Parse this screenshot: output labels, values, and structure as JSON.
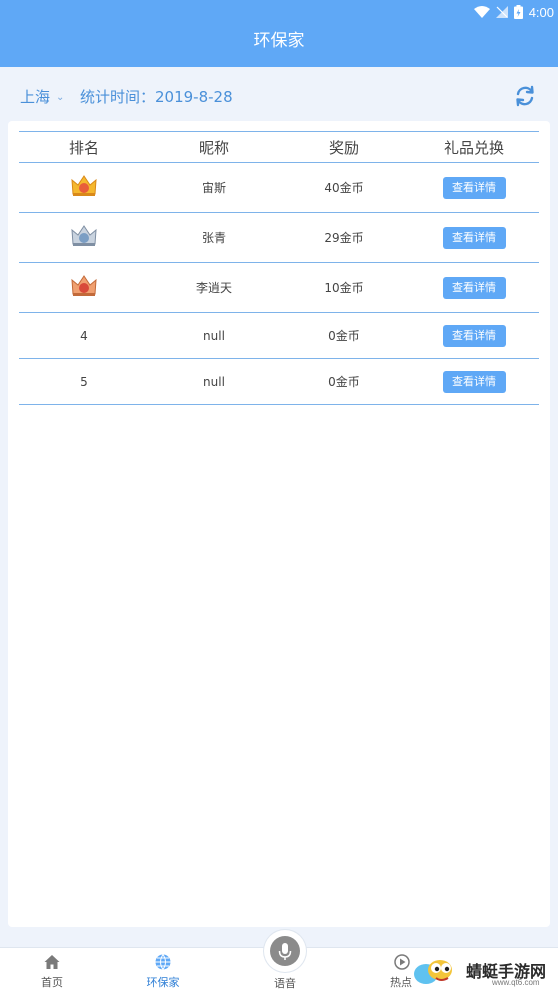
{
  "status": {
    "time": "4:00"
  },
  "header": {
    "title": "环保家"
  },
  "filter": {
    "city": "上海",
    "stat_label": "统计时间：2019-8-28"
  },
  "table": {
    "headers": [
      "排名",
      "昵称",
      "奖励",
      "礼品兑换"
    ],
    "rows": [
      {
        "rank": "",
        "name": "宙斯",
        "reward": "40金币",
        "action": "查看详情"
      },
      {
        "rank": "",
        "name": "张青",
        "reward": "29金币",
        "action": "查看详情"
      },
      {
        "rank": "",
        "name": "李逍天",
        "reward": "10金币",
        "action": "查看详情"
      },
      {
        "rank": "4",
        "name": "null",
        "reward": "0金币",
        "action": "查看详情"
      },
      {
        "rank": "5",
        "name": "null",
        "reward": "0金币",
        "action": "查看详情"
      }
    ]
  },
  "tabs": [
    {
      "label": "首页",
      "icon": "home-icon"
    },
    {
      "label": "环保家",
      "icon": "globe-icon"
    },
    {
      "label": "语音",
      "icon": "microphone-icon"
    },
    {
      "label": "热点",
      "icon": "play-icon"
    }
  ],
  "watermark": {
    "text": "蜻蜓手游网",
    "url": "www.qt6.com"
  },
  "colors": {
    "accent": "#5fa8f6",
    "link": "#4a90d9",
    "divider": "#7eb3ea"
  }
}
